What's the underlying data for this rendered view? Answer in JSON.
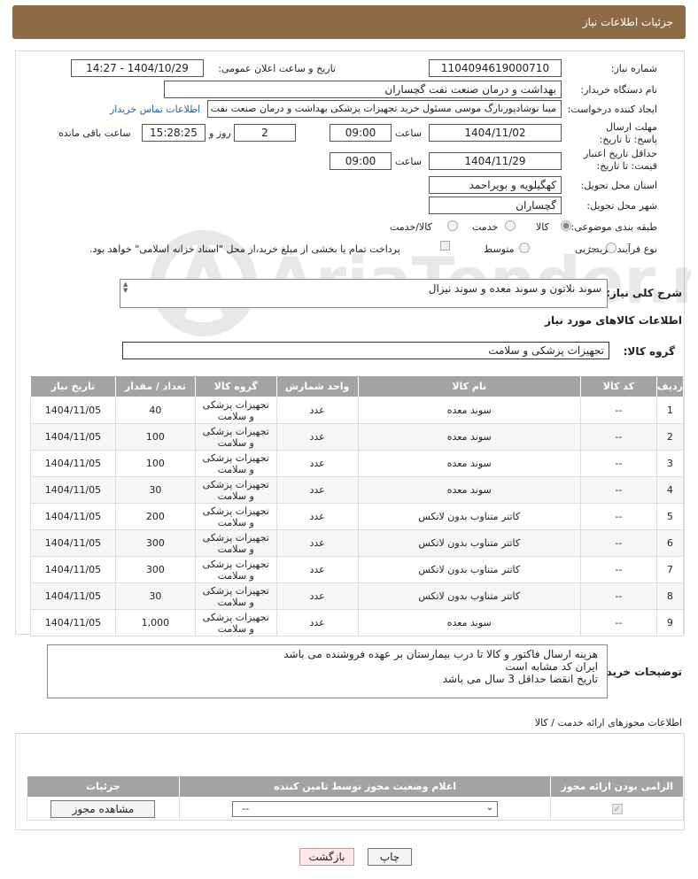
{
  "page_title": "جزئیات اطلاعات نیاز",
  "labels": {
    "need_number": "شماره نیاز:",
    "announce_datetime": "تاریخ و ساعت اعلان عمومی:",
    "buyer_org": "نام دستگاه خریدار:",
    "requester": "ایجاد کننده درخواست:",
    "buyer_contact": "اطلاعات تماس خریدار",
    "reply_deadline": "مهلت ارسال پاسخ: تا تاریخ:",
    "price_validity": "حداقل تاریخ اعتبار قیمت: تا تاریخ:",
    "time": "ساعت",
    "day_and": "روز و",
    "hours_left": "ساعت باقی مانده",
    "province": "استان محل تحویل:",
    "city": "شهر محل تحویل:",
    "subject_class": "طبقه بندی موضوعی:",
    "purchase_type": "نوع فرآیند خرید :",
    "need_desc": "شرح کلی نیاز:",
    "goods_info": "اطلاعات کالاهای مورد نیاز",
    "goods_group": "گروه کالا:",
    "buyer_notes": "توضیحات خریدار:",
    "license_info": "اطلاعات مجوزهای ارائه خدمت / کالا"
  },
  "values": {
    "need_number": "1104094619000710",
    "announce_datetime": "1404/10/29 - 14:27",
    "buyer_org": "بهداشت و درمان صنعت نفت گچساران",
    "requester": "مینا نوشادپورنارگ موسی مسئول خرید تجهیزات پزشکی  بهداشت و درمان صنعت نفت",
    "reply_date": "1404/11/02",
    "reply_time": "09:00",
    "days_left": "2",
    "time_left": "15:28:25",
    "validity_date": "1404/11/29",
    "validity_time": "09:00",
    "province": "کهگیلویه و بویراحمد",
    "city": "گچساران",
    "need_desc": "سوند نلاتون و سوند معده و سوند نیزال",
    "goods_group": "تجهیزات پزشکی و سلامت",
    "buyer_notes_1": "هزینه ارسال فاکتور و کالا تا درب بیمارستان بر عهده فروشنده می باشد",
    "buyer_notes_2": "ایران کد مشابه است",
    "buyer_notes_3": "تاریخ انقضا حداقل 3 سال می باشد"
  },
  "subject_options": {
    "goods": "کالا",
    "service": "خدمت",
    "goods_service": "کالا/خدمت"
  },
  "purchase_options": {
    "minor": "جزیی",
    "medium": "متوسط",
    "payment_note": "پرداخت تمام یا بخشی از مبلغ خرید،از محل \"اسناد خزانه اسلامی\" خواهد بود."
  },
  "items_table": {
    "headers": {
      "row": "ردیف",
      "code": "کد کالا",
      "name": "نام کالا",
      "unit": "واحد شمارش",
      "group": "گروه کالا",
      "qty": "تعداد / مقدار",
      "date": "تاریخ نیاز"
    },
    "rows": [
      {
        "row": "1",
        "code": "--",
        "name": "سوند معده",
        "unit": "عدد",
        "group": "تجهیزات پزشکی و سلامت",
        "qty": "40",
        "date": "1404/11/05"
      },
      {
        "row": "2",
        "code": "--",
        "name": "سوند معده",
        "unit": "عدد",
        "group": "تجهیزات پزشکی و سلامت",
        "qty": "100",
        "date": "1404/11/05"
      },
      {
        "row": "3",
        "code": "--",
        "name": "سوند معده",
        "unit": "عدد",
        "group": "تجهیزات پزشکی و سلامت",
        "qty": "100",
        "date": "1404/11/05"
      },
      {
        "row": "4",
        "code": "--",
        "name": "سوند معده",
        "unit": "عدد",
        "group": "تجهیزات پزشکی و سلامت",
        "qty": "30",
        "date": "1404/11/05"
      },
      {
        "row": "5",
        "code": "--",
        "name": "کاتتر متناوب بدون لاتکس",
        "unit": "عدد",
        "group": "تجهیزات پزشکی و سلامت",
        "qty": "200",
        "date": "1404/11/05"
      },
      {
        "row": "6",
        "code": "--",
        "name": "کاتتر متناوب بدون لاتکس",
        "unit": "عدد",
        "group": "تجهیزات پزشکی و سلامت",
        "qty": "300",
        "date": "1404/11/05"
      },
      {
        "row": "7",
        "code": "--",
        "name": "کاتتر متناوب بدون لاتکس",
        "unit": "عدد",
        "group": "تجهیزات پزشکی و سلامت",
        "qty": "300",
        "date": "1404/11/05"
      },
      {
        "row": "8",
        "code": "--",
        "name": "کاتتر متناوب بدون لاتکس",
        "unit": "عدد",
        "group": "تجهیزات پزشکی و سلامت",
        "qty": "30",
        "date": "1404/11/05"
      },
      {
        "row": "9",
        "code": "--",
        "name": "سوند معده",
        "unit": "عدد",
        "group": "تجهیزات پزشکی و سلامت",
        "qty": "1,000",
        "date": "1404/11/05"
      }
    ]
  },
  "license_table": {
    "headers": {
      "required": "الزامی بودن ارائه مجوز",
      "status": "اعلام وضعیت مجوز توسط تامین کننده",
      "details": "جزئیات"
    },
    "select_value": "--",
    "view_button": "مشاهده مجوز"
  },
  "buttons": {
    "print": "چاپ",
    "back": "بازگشت"
  },
  "watermark": "AriaTender.neT"
}
